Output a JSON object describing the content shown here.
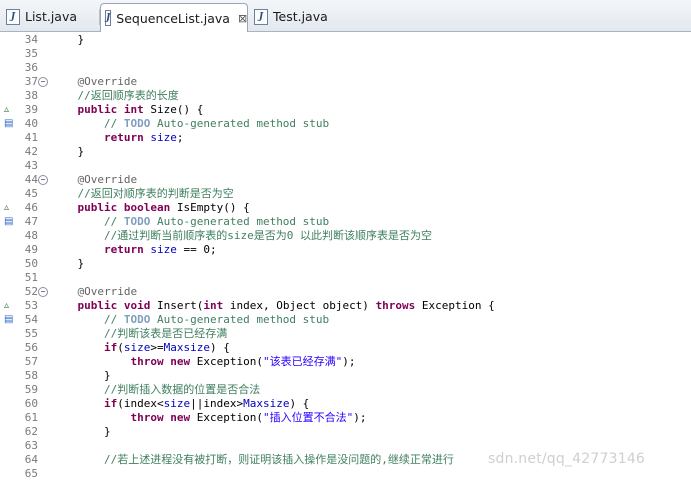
{
  "tabs": [
    {
      "label": "List.java",
      "active": false,
      "icon": "java-file-icon"
    },
    {
      "label": "SequenceList.java",
      "active": true,
      "icon": "java-file-icon",
      "close": "⊠"
    },
    {
      "label": "Test.java",
      "active": false,
      "icon": "java-file-icon"
    }
  ],
  "code_lines": [
    {
      "n": "34",
      "text": "    }"
    },
    {
      "n": "35",
      "text": ""
    },
    {
      "n": "36",
      "text": ""
    },
    {
      "n": "37",
      "fold": "−",
      "text": "    @Override"
    },
    {
      "n": "38",
      "text": "    //返回顺序表的长度"
    },
    {
      "n": "39",
      "marker": "override",
      "text": "    public int Size() {"
    },
    {
      "n": "40",
      "marker": "task",
      "text": "        // TODO Auto-generated method stub"
    },
    {
      "n": "41",
      "text": "        return size;"
    },
    {
      "n": "42",
      "text": "    }"
    },
    {
      "n": "43",
      "text": ""
    },
    {
      "n": "44",
      "fold": "−",
      "text": "    @Override"
    },
    {
      "n": "45",
      "text": "    //返回对顺序表的判断是否为空"
    },
    {
      "n": "46",
      "marker": "override",
      "text": "    public boolean IsEmpty() {"
    },
    {
      "n": "47",
      "marker": "task",
      "text": "        // TODO Auto-generated method stub"
    },
    {
      "n": "48",
      "text": "        //通过判断当前顺序表的size是否为0 以此判断该顺序表是否为空"
    },
    {
      "n": "49",
      "text": "        return size == 0;"
    },
    {
      "n": "50",
      "text": "    }"
    },
    {
      "n": "51",
      "text": ""
    },
    {
      "n": "52",
      "fold": "−",
      "text": "    @Override"
    },
    {
      "n": "53",
      "marker": "override",
      "text": "    public void Insert(int index, Object object) throws Exception {"
    },
    {
      "n": "54",
      "marker": "task",
      "text": "        // TODO Auto-generated method stub"
    },
    {
      "n": "55",
      "text": "        //判断该表是否已经存满"
    },
    {
      "n": "56",
      "text": "        if(size>=Maxsize) {"
    },
    {
      "n": "57",
      "text": "            throw new Exception(\"该表已经存满\");"
    },
    {
      "n": "58",
      "text": "        }"
    },
    {
      "n": "59",
      "text": "        //判断插入数据的位置是否合法"
    },
    {
      "n": "60",
      "text": "        if(index<size||index>Maxsize) {"
    },
    {
      "n": "61",
      "text": "            throw new Exception(\"插入位置不合法\");"
    },
    {
      "n": "62",
      "text": "        }"
    },
    {
      "n": "63",
      "text": ""
    },
    {
      "n": "64",
      "text": "        //若上述进程没有被打断，则证明该插入操作是没问题的,继续正常进行"
    },
    {
      "n": "65",
      "text": ""
    }
  ],
  "watermark": "sdn.net/qq_42773146",
  "colors": {
    "keyword": "#7f0055",
    "comment": "#3f7f5f",
    "todo": "#7f9fbf",
    "field": "#0000c0",
    "string": "#2a00ff",
    "annotation": "#646464"
  }
}
